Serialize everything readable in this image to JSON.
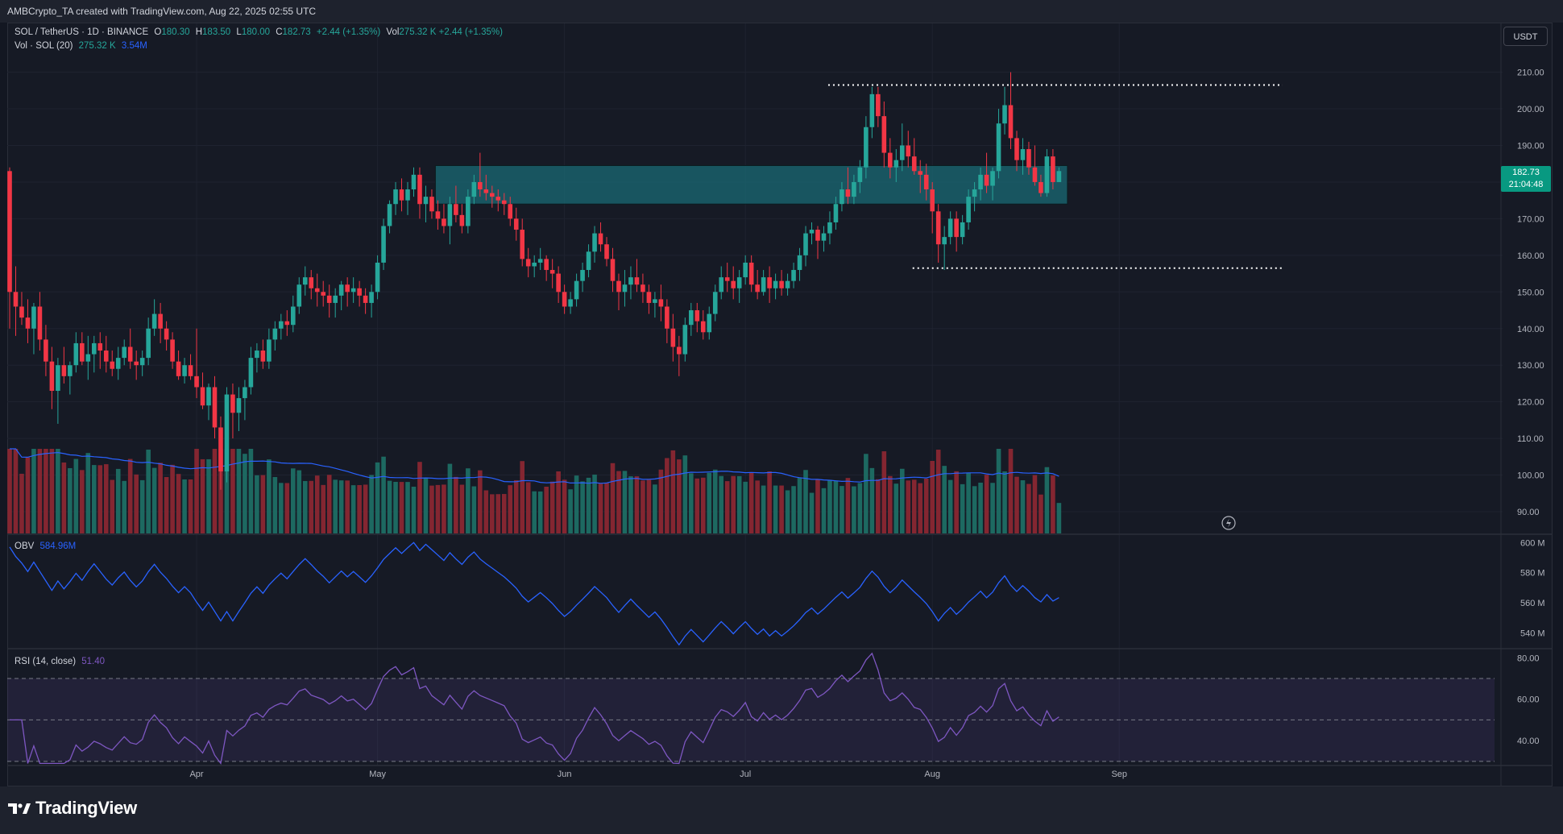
{
  "header": {
    "attribution": "AMBCrypto_TA created with TradingView.com, Aug 22, 2025 02:55 UTC"
  },
  "legend": {
    "symbol": "SOL / TetherUS · 1D · BINANCE",
    "o_label": "O",
    "o_value": "180.30",
    "h_label": "H",
    "h_value": "183.50",
    "l_label": "L",
    "l_value": "180.00",
    "c_label": "C",
    "c_value": "182.73",
    "change": "+2.44 (+1.35%)",
    "vol_label": "Vol",
    "vol_value": "275.32 K",
    "vol_change": "+2.44 (+1.35%)",
    "volume_indicator": "Vol · SOL (20)",
    "volume_value": "275.32 K",
    "volume_ma_value": "3.54M"
  },
  "currency_button": "USDT",
  "price_tag": {
    "price": "182.73",
    "countdown": "21:04:48"
  },
  "obv_legend": {
    "label": "OBV",
    "value": "584.96M"
  },
  "rsi_legend": {
    "label": "RSI (14, close)",
    "value": "51.40"
  },
  "footer": {
    "brand": "TradingView"
  },
  "colors": {
    "up": "#26a69a",
    "down": "#f23645",
    "volume_ma": "#2962ff",
    "obv": "#2962ff",
    "rsi": "#7e57c2",
    "zone": "#1a6a74"
  },
  "chart_data": [
    {
      "type": "candlestick",
      "title": "SOL / TetherUS · 1D · BINANCE",
      "x_ticks": [
        "Apr",
        "May",
        "Jun",
        "Jul",
        "Aug",
        "Sep"
      ],
      "y_ticks": [
        "90.00",
        "100.00",
        "110.00",
        "120.00",
        "130.00",
        "140.00",
        "150.00",
        "160.00",
        "170.00",
        "180.00",
        "190.00",
        "200.00",
        "210.00"
      ],
      "ylim": [
        85,
        213
      ],
      "start_date": "2025-03-01",
      "ohlc": [
        [
          183,
          184,
          140,
          150
        ],
        [
          150,
          157,
          138,
          146
        ],
        [
          146,
          150,
          141,
          143
        ],
        [
          143,
          148,
          136,
          140
        ],
        [
          140,
          147,
          133,
          146
        ],
        [
          146,
          150,
          134,
          137
        ],
        [
          137,
          141,
          127,
          131
        ],
        [
          131,
          135,
          118,
          123
        ],
        [
          123,
          132,
          114,
          130
        ],
        [
          130,
          135,
          125,
          127
        ],
        [
          127,
          131,
          122,
          130
        ],
        [
          130,
          139,
          128,
          136
        ],
        [
          136,
          139,
          130,
          131
        ],
        [
          131,
          138,
          126,
          133
        ],
        [
          133,
          138,
          128,
          136
        ],
        [
          136,
          139,
          129,
          134
        ],
        [
          134,
          138,
          128,
          131
        ],
        [
          131,
          134,
          127,
          129
        ],
        [
          129,
          135,
          126,
          132
        ],
        [
          132,
          137,
          130,
          135
        ],
        [
          135,
          140,
          129,
          131
        ],
        [
          131,
          134,
          126,
          130
        ],
        [
          130,
          134,
          127,
          132
        ],
        [
          132,
          143,
          130,
          140
        ],
        [
          140,
          148,
          138,
          144
        ],
        [
          144,
          147,
          136,
          140
        ],
        [
          140,
          142,
          134,
          137
        ],
        [
          137,
          139,
          129,
          131
        ],
        [
          131,
          134,
          126,
          127
        ],
        [
          127,
          132,
          125,
          130
        ],
        [
          130,
          133,
          126,
          127
        ],
        [
          127,
          140,
          121,
          124
        ],
        [
          124,
          128,
          118,
          119
        ],
        [
          119,
          125,
          115,
          124
        ],
        [
          124,
          127,
          110,
          113
        ],
        [
          113,
          116,
          96,
          101
        ],
        [
          101,
          124,
          98,
          122
        ],
        [
          122,
          125,
          110,
          117
        ],
        [
          117,
          124,
          112,
          121
        ],
        [
          121,
          126,
          115,
          124
        ],
        [
          124,
          135,
          122,
          132
        ],
        [
          132,
          136,
          128,
          134
        ],
        [
          134,
          137,
          129,
          131
        ],
        [
          131,
          140,
          129,
          137
        ],
        [
          137,
          142,
          134,
          140
        ],
        [
          140,
          144,
          137,
          142
        ],
        [
          142,
          145,
          138,
          141
        ],
        [
          141,
          149,
          139,
          146
        ],
        [
          146,
          154,
          144,
          152
        ],
        [
          152,
          157,
          149,
          154
        ],
        [
          154,
          156,
          148,
          151
        ],
        [
          151,
          155,
          146,
          150
        ],
        [
          150,
          153,
          146,
          149
        ],
        [
          149,
          152,
          143,
          147
        ],
        [
          147,
          151,
          143,
          149
        ],
        [
          149,
          153,
          145,
          152
        ],
        [
          152,
          154,
          146,
          150
        ],
        [
          150,
          154,
          147,
          151
        ],
        [
          151,
          153,
          146,
          149
        ],
        [
          149,
          151,
          144,
          147
        ],
        [
          147,
          152,
          143,
          150
        ],
        [
          150,
          160,
          148,
          158
        ],
        [
          158,
          170,
          156,
          168
        ],
        [
          168,
          175,
          166,
          174
        ],
        [
          174,
          180,
          171,
          178
        ],
        [
          178,
          181,
          172,
          175
        ],
        [
          175,
          180,
          171,
          178
        ],
        [
          178,
          184,
          176,
          182
        ],
        [
          182,
          184,
          170,
          174
        ],
        [
          174,
          179,
          169,
          176
        ],
        [
          176,
          178,
          170,
          172
        ],
        [
          172,
          175,
          167,
          170
        ],
        [
          170,
          174,
          166,
          168
        ],
        [
          168,
          176,
          163,
          174
        ],
        [
          174,
          179,
          169,
          171
        ],
        [
          171,
          174,
          166,
          168
        ],
        [
          168,
          178,
          166,
          176
        ],
        [
          176,
          182,
          174,
          180
        ],
        [
          180,
          188,
          176,
          178
        ],
        [
          178,
          182,
          175,
          177
        ],
        [
          177,
          179,
          173,
          176
        ],
        [
          176,
          178,
          172,
          175
        ],
        [
          175,
          177,
          171,
          174
        ],
        [
          174,
          176,
          168,
          170
        ],
        [
          170,
          173,
          164,
          167
        ],
        [
          167,
          170,
          157,
          159
        ],
        [
          159,
          162,
          154,
          157
        ],
        [
          157,
          160,
          154,
          158
        ],
        [
          158,
          162,
          156,
          159
        ],
        [
          159,
          160,
          153,
          156
        ],
        [
          156,
          159,
          151,
          155
        ],
        [
          155,
          157,
          147,
          150
        ],
        [
          150,
          152,
          144,
          146
        ],
        [
          146,
          150,
          144,
          148
        ],
        [
          148,
          155,
          146,
          153
        ],
        [
          153,
          158,
          150,
          156
        ],
        [
          156,
          163,
          154,
          161
        ],
        [
          161,
          168,
          158,
          166
        ],
        [
          166,
          169,
          161,
          163
        ],
        [
          163,
          165,
          157,
          159
        ],
        [
          159,
          162,
          150,
          153
        ],
        [
          153,
          155,
          145,
          150
        ],
        [
          150,
          156,
          146,
          152
        ],
        [
          152,
          157,
          148,
          154
        ],
        [
          154,
          159,
          150,
          152
        ],
        [
          152,
          155,
          147,
          150
        ],
        [
          150,
          152,
          144,
          147
        ],
        [
          147,
          150,
          143,
          148
        ],
        [
          148,
          152,
          142,
          146
        ],
        [
          146,
          148,
          136,
          140
        ],
        [
          140,
          144,
          131,
          135
        ],
        [
          135,
          138,
          127,
          133
        ],
        [
          133,
          143,
          131,
          141
        ],
        [
          141,
          147,
          138,
          145
        ],
        [
          145,
          147,
          139,
          142
        ],
        [
          142,
          145,
          137,
          139
        ],
        [
          139,
          146,
          137,
          144
        ],
        [
          144,
          152,
          142,
          150
        ],
        [
          150,
          157,
          148,
          154
        ],
        [
          154,
          158,
          150,
          153
        ],
        [
          153,
          157,
          148,
          151
        ],
        [
          151,
          156,
          147,
          154
        ],
        [
          154,
          160,
          152,
          158
        ],
        [
          158,
          160,
          150,
          152
        ],
        [
          152,
          156,
          148,
          150
        ],
        [
          150,
          156,
          149,
          154
        ],
        [
          154,
          157,
          147,
          151
        ],
        [
          151,
          155,
          148,
          153
        ],
        [
          153,
          156,
          149,
          151
        ],
        [
          151,
          155,
          149,
          153
        ],
        [
          153,
          158,
          151,
          156
        ],
        [
          156,
          162,
          153,
          160
        ],
        [
          160,
          168,
          157,
          166
        ],
        [
          166,
          169,
          163,
          167
        ],
        [
          167,
          168,
          159,
          164
        ],
        [
          164,
          168,
          161,
          166
        ],
        [
          166,
          172,
          163,
          169
        ],
        [
          169,
          176,
          167,
          174
        ],
        [
          174,
          180,
          172,
          178
        ],
        [
          178,
          184,
          174,
          176
        ],
        [
          176,
          182,
          174,
          180
        ],
        [
          180,
          186,
          177,
          184
        ],
        [
          184,
          198,
          181,
          195
        ],
        [
          195,
          206,
          192,
          204
        ],
        [
          204,
          206,
          195,
          198
        ],
        [
          198,
          202,
          184,
          188
        ],
        [
          188,
          192,
          181,
          184
        ],
        [
          184,
          189,
          180,
          186
        ],
        [
          186,
          196,
          183,
          190
        ],
        [
          190,
          194,
          184,
          187
        ],
        [
          187,
          192,
          182,
          183
        ],
        [
          183,
          186,
          177,
          182
        ],
        [
          182,
          185,
          175,
          178
        ],
        [
          178,
          180,
          166,
          172
        ],
        [
          172,
          174,
          158,
          163
        ],
        [
          163,
          168,
          156,
          165
        ],
        [
          165,
          172,
          163,
          170
        ],
        [
          170,
          172,
          161,
          165
        ],
        [
          165,
          171,
          163,
          169
        ],
        [
          169,
          178,
          167,
          176
        ],
        [
          176,
          180,
          172,
          178
        ],
        [
          178,
          184,
          175,
          182
        ],
        [
          182,
          188,
          177,
          179
        ],
        [
          179,
          184,
          175,
          183
        ],
        [
          183,
          200,
          181,
          196
        ],
        [
          196,
          206,
          193,
          201
        ],
        [
          201,
          210,
          189,
          192
        ],
        [
          192,
          194,
          183,
          186
        ],
        [
          186,
          192,
          182,
          189
        ],
        [
          189,
          191,
          182,
          184
        ],
        [
          184,
          190,
          179,
          180
        ],
        [
          180,
          182,
          176,
          177
        ],
        [
          177,
          189,
          176,
          187
        ],
        [
          187,
          189,
          178,
          180
        ],
        [
          180,
          184,
          180,
          183
        ]
      ],
      "volume_ma": "Vol · SOL (20)",
      "zone": {
        "y0": 174,
        "y1": 184.5,
        "x_from_index": 71,
        "x_to_index": 175
      },
      "resistance": {
        "y": 206.5,
        "from_index": 136,
        "to_index": 175
      },
      "support": {
        "y": 156.5,
        "from_index": 150,
        "to_index": 175
      }
    },
    {
      "type": "line",
      "title": "OBV",
      "y_ticks": [
        "540 M",
        "560 M",
        "580 M",
        "600 M"
      ],
      "ylim": [
        530,
        605
      ],
      "last_value": 584.96
    },
    {
      "type": "line",
      "title": "RSI (14, close)",
      "y_ticks": [
        "40.00",
        "60.00",
        "80.00"
      ],
      "ylim": [
        28,
        84
      ],
      "bands": [
        30,
        50,
        70
      ],
      "last_value": 51.4
    }
  ]
}
